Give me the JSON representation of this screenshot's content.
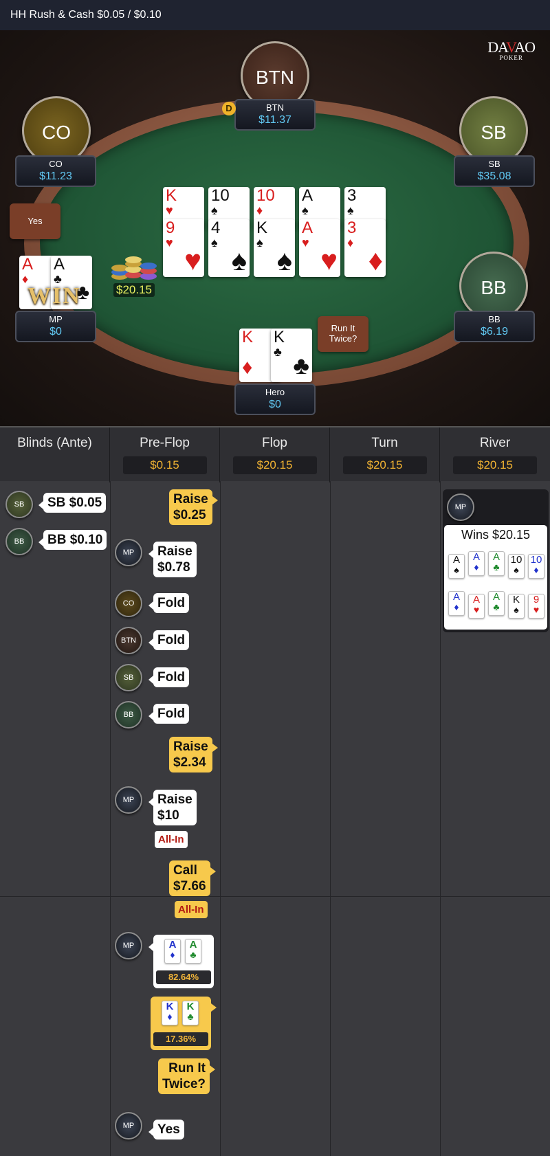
{
  "header": {
    "title": "HH  Rush & Cash $0.05 / $0.10"
  },
  "logo": {
    "main_a": "DA",
    "main_v": "V",
    "main_b": "AO",
    "sub": "POKER"
  },
  "seats": {
    "btn": {
      "avatar": "BTN",
      "name": "BTN",
      "stack": "$11.37"
    },
    "co": {
      "avatar": "CO",
      "name": "CO",
      "stack": "$11.23"
    },
    "sb": {
      "avatar": "SB",
      "name": "SB",
      "stack": "$35.08"
    },
    "bb": {
      "avatar": "BB",
      "name": "BB",
      "stack": "$6.19"
    },
    "mp": {
      "name": "MP",
      "stack": "$0",
      "cards": [
        {
          "rank": "A",
          "suit": "♦"
        },
        {
          "rank": "A",
          "suit": "♣"
        }
      ],
      "win": "WIN"
    },
    "hero": {
      "name": "Hero",
      "stack": "$0",
      "cards": [
        {
          "rank": "K",
          "suit": "♦"
        },
        {
          "rank": "K",
          "suit": "♣"
        }
      ]
    }
  },
  "dealer_button": "D",
  "pot": "$20.15",
  "board_top": [
    {
      "rank": "K",
      "suit": "♥"
    },
    {
      "rank": "10",
      "suit": "♠"
    },
    {
      "rank": "10",
      "suit": "♦"
    },
    {
      "rank": "A",
      "suit": "♠"
    },
    {
      "rank": "3",
      "suit": "♠"
    }
  ],
  "board_bottom": [
    {
      "rank": "9",
      "suit": "♥"
    },
    {
      "rank": "4",
      "suit": "♠"
    },
    {
      "rank": "K",
      "suit": "♠"
    },
    {
      "rank": "A",
      "suit": "♥"
    },
    {
      "rank": "3",
      "suit": "♦"
    }
  ],
  "yes_button": "Yes",
  "run_it_twice_button": "Run It Twice?",
  "history": {
    "columns": [
      {
        "title": "Blinds (Ante)",
        "pot": ""
      },
      {
        "title": "Pre-Flop",
        "pot": "$0.15"
      },
      {
        "title": "Flop",
        "pot": "$20.15"
      },
      {
        "title": "Turn",
        "pot": "$20.15"
      },
      {
        "title": "River",
        "pot": "$20.15"
      }
    ],
    "blinds": [
      {
        "chip": "SB",
        "text": "SB $0.05"
      },
      {
        "chip": "BB",
        "text": "BB $0.10"
      }
    ],
    "preflop": {
      "a1_l1": "Raise",
      "a1_l2": "$0.25",
      "a2_l1": "Raise",
      "a2_l2": "$0.78",
      "fold": "Fold",
      "a3_l1": "Raise",
      "a3_l2": "$2.34",
      "a4_l1": "Raise",
      "a4_l2": "$10",
      "allin": "All-In",
      "a5_l1": "Call",
      "a5_l2": "$7.66",
      "mp_equity": "82.64%",
      "hero_equity": "17.36%",
      "rit_l1": "Run It",
      "rit_l2": "Twice?",
      "yes": "Yes"
    },
    "chips": {
      "mp": "MP",
      "co": "CO",
      "btn": "BTN",
      "sb": "SB",
      "bb": "BB"
    },
    "river": {
      "winner": "MP",
      "wins": "Wins $20.15",
      "row1": [
        {
          "r": "A",
          "s": "♠"
        },
        {
          "r": "A",
          "s": "♦"
        },
        {
          "r": "A",
          "s": "♣"
        },
        {
          "r": "10",
          "s": "♠"
        },
        {
          "r": "10",
          "s": "♦"
        }
      ],
      "row2": [
        {
          "r": "A",
          "s": "♦"
        },
        {
          "r": "A",
          "s": "♥"
        },
        {
          "r": "A",
          "s": "♣"
        },
        {
          "r": "K",
          "s": "♠"
        },
        {
          "r": "9",
          "s": "♥"
        }
      ]
    }
  }
}
